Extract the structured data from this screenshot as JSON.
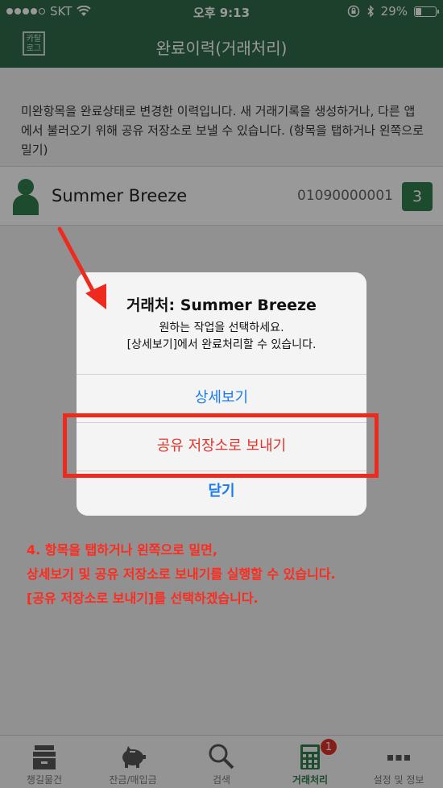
{
  "status_bar": {
    "carrier": "SKT",
    "time": "오후 9:13",
    "battery": "29%",
    "battery_level": 0.29
  },
  "nav": {
    "logo_line1": "카탈",
    "logo_line2": "로그",
    "title": "완료이력(거래처리)"
  },
  "main": {
    "description": "미완항목을 완료상태로 변경한 이력입니다. 새 거래기록을 생성하거나, 다른 앱에서 불러오기 위해 공유 저장소로 보낼 수 있습니다. (항목을 탭하거나 왼쪽으로 밀기)",
    "items": [
      {
        "name": "Summer Breeze",
        "phone": "01090000001",
        "count": "3"
      }
    ]
  },
  "alert": {
    "title": "거래처: Summer Breeze",
    "message_line1": "원하는 작업을 선택하세요.",
    "message_line2": "[상세보기]에서 완료처리할 수 있습니다.",
    "buttons": [
      "상세보기",
      "공유 저장소로 보내기",
      "닫기"
    ]
  },
  "annotation": {
    "line1": "4. 항목을 탭하거나 왼쪽으로 밀면,",
    "line2": "상세보기 및 공유 저장소로 보내기를 실행할 수 있습니다.",
    "line3": "[공유 저장소로 보내기]를 선택하겠습니다."
  },
  "tabs": [
    {
      "label": "챙길물건",
      "icon": "archive-box-icon",
      "active": false
    },
    {
      "label": "잔금/매입금",
      "icon": "piggy-bank-icon",
      "active": false
    },
    {
      "label": "검색",
      "icon": "search-icon",
      "active": false
    },
    {
      "label": "거래처리",
      "icon": "calculator-icon",
      "active": true,
      "badge": "1"
    },
    {
      "label": "설정 및 정보",
      "icon": "more-dots-icon",
      "active": false
    }
  ],
  "colors": {
    "brand_green": "#2f6b48",
    "badge_green": "#2f7d4c",
    "ios_blue": "#1a7cf0",
    "destructive_red": "#e5342d",
    "annotation_red": "#ff2a1e"
  }
}
